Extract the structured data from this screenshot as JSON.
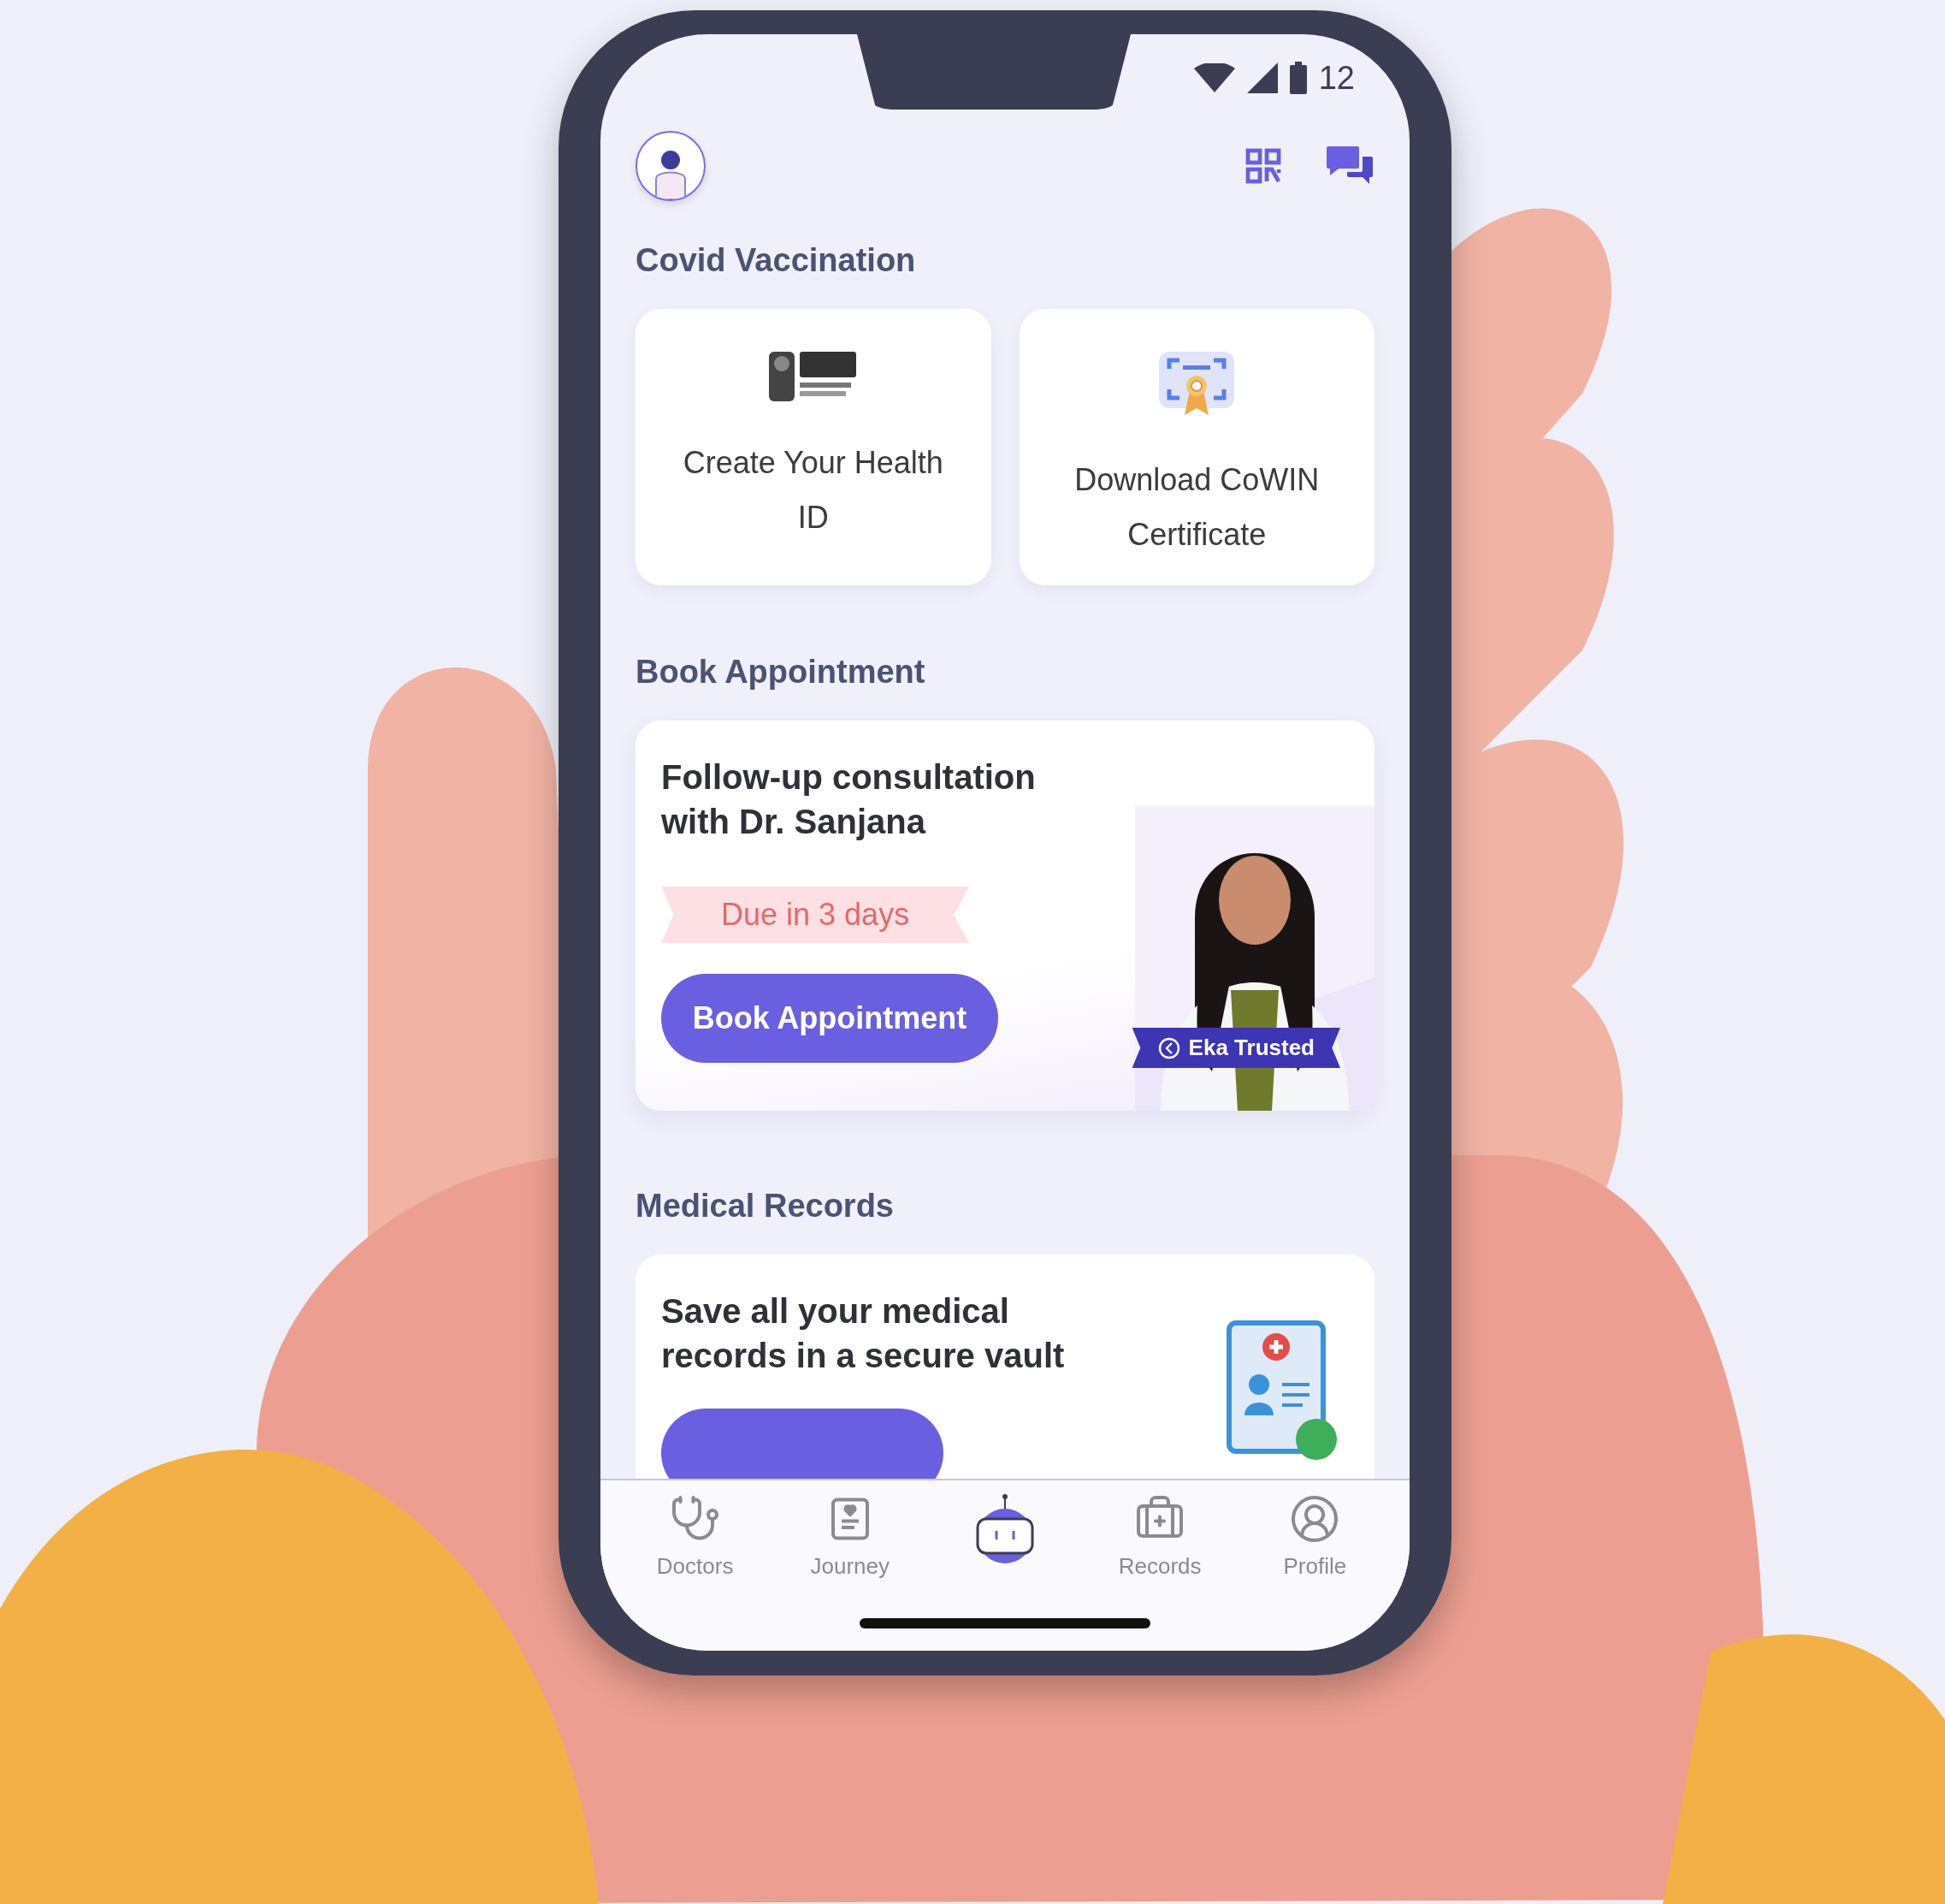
{
  "status_bar": {
    "time": "12"
  },
  "covid_vaccination": {
    "title": "Covid Vaccination",
    "cards": [
      {
        "kind": "logo",
        "label": "Create Your Health ID"
      },
      {
        "kind": "certificate",
        "label": "Download CoWIN Certificate"
      }
    ]
  },
  "book_appointment": {
    "title": "Book Appointment",
    "card": {
      "title": "Follow-up consultation with Dr. Sanjana",
      "due": "Due in 3 days",
      "button": "Book Appointment",
      "badge": "Eka Trusted"
    }
  },
  "medical_records": {
    "title": "Medical Records",
    "card": {
      "text": "Save all your medical records in a secure vault"
    }
  },
  "bottom_nav": [
    {
      "kind": "doctors",
      "label": "Doctors",
      "selected": false
    },
    {
      "kind": "journey",
      "label": "Journey",
      "selected": false
    },
    {
      "kind": "bot",
      "selected": false
    },
    {
      "kind": "records",
      "label": "Records",
      "selected": false
    },
    {
      "kind": "profile",
      "label": "Profile",
      "selected": false
    }
  ]
}
